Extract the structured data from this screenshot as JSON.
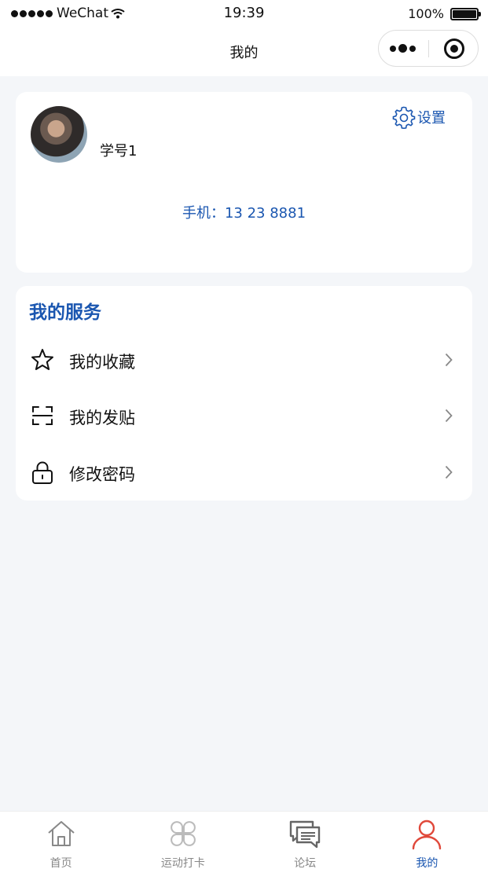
{
  "status_bar": {
    "carrier": "WeChat",
    "time": "19:39",
    "battery": "100%"
  },
  "nav": {
    "title": "我的"
  },
  "profile": {
    "username": "学号1",
    "settings_label": "设置",
    "phone": "手机：13 23 8881"
  },
  "services": {
    "title": "我的服务",
    "items": [
      {
        "label": "我的收藏",
        "icon": "star-icon"
      },
      {
        "label": "我的发贴",
        "icon": "scan-icon"
      },
      {
        "label": "修改密码",
        "icon": "lock-icon"
      }
    ]
  },
  "tabbar": {
    "tabs": [
      {
        "label": "首页",
        "icon": "home-icon",
        "active": false
      },
      {
        "label": "运动打卡",
        "icon": "clover-icon",
        "active": false
      },
      {
        "label": "论坛",
        "icon": "chat-icon",
        "active": false
      },
      {
        "label": "我的",
        "icon": "person-icon",
        "active": true
      }
    ]
  },
  "colors": {
    "accent": "#1a56b0",
    "active_tab_icon": "#e0483a",
    "background": "#f4f6f9"
  }
}
